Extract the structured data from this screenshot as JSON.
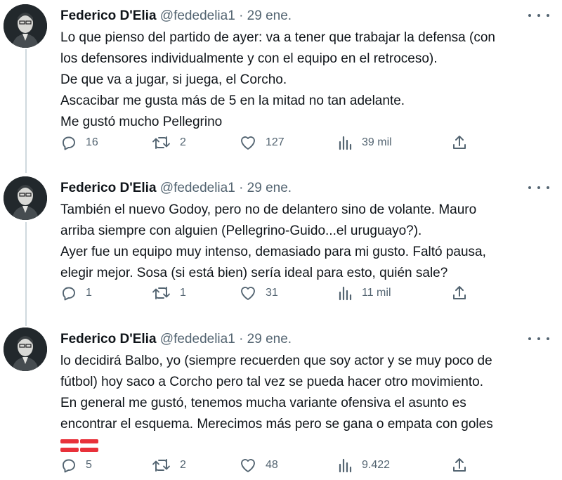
{
  "tweets": [
    {
      "author_name": "Federico D'Elia",
      "handle": "@fededelia1",
      "separator": "·",
      "date": "29 ene.",
      "lines": [
        "Lo que pienso del partido de ayer: va a tener que trabajar la defensa (con",
        "los defensores individualmente y con el equipo en el retroceso).",
        "De que va a jugar, si juega, el Corcho.",
        "Ascacibar me gusta más de 5 en la mitad no tan adelante.",
        "Me gustó mucho Pellegrino"
      ],
      "stats": {
        "replies": "16",
        "retweets": "2",
        "likes": "127",
        "views": "39 mil"
      }
    },
    {
      "author_name": "Federico D'Elia",
      "handle": "@fededelia1",
      "separator": "·",
      "date": "29 ene.",
      "lines": [
        "También el nuevo Godoy, pero no de delantero sino de volante. Mauro",
        "arriba siempre con alguien (Pellegrino-Guido...el uruguayo?).",
        "Ayer fue un equipo muy intenso, demasiado para mi gusto. Faltó pausa,",
        "elegir mejor. Sosa (si está bien) sería ideal para esto, quién sale?"
      ],
      "stats": {
        "replies": "1",
        "retweets": "1",
        "likes": "31",
        "views": "11 mil"
      }
    },
    {
      "author_name": "Federico D'Elia",
      "handle": "@fededelia1",
      "separator": "·",
      "date": "29 ene.",
      "lines": [
        "lo decidirá Balbo, yo (siempre recuerden que soy actor y se muy poco de",
        "fútbol) hoy saco a Corcho pero tal vez se pueda hacer otro movimiento.",
        "En general me gustó, tenemos mucha variante ofensiva el asunto es",
        "encontrar el esquema. Merecimos más pero se gana o empata con goles"
      ],
      "emoji": [
        "flag-emoji-red-white",
        "flag-emoji-red-white"
      ],
      "stats": {
        "replies": "5",
        "retweets": "2",
        "likes": "48",
        "views": "9.422"
      }
    }
  ],
  "icons": {
    "reply": "reply-icon",
    "retweet": "retweet-icon",
    "like": "like-icon",
    "views": "views-icon",
    "share": "share-icon",
    "more": "more-icon"
  },
  "colors": {
    "text_primary": "#0f1419",
    "text_secondary": "#536471",
    "thread_line": "#cfd9de",
    "flag_red": "#e8313a"
  }
}
